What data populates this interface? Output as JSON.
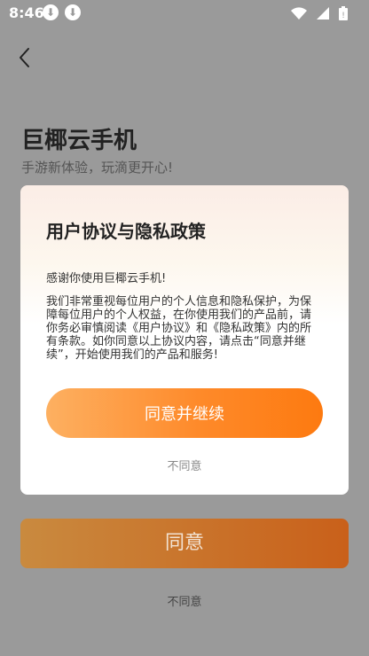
{
  "status_bar": {
    "time": "8:46",
    "icons": [
      "download-icon",
      "download-icon",
      "wifi-icon",
      "signal-icon",
      "battery-icon"
    ]
  },
  "header": {
    "app_title": "巨椰云手机",
    "subtitle": "手游新体验，玩滴更开心!"
  },
  "background_actions": {
    "agree_label": "同意",
    "disagree_label": "不同意"
  },
  "dialog": {
    "title": "用户协议与隐私政策",
    "greeting": "感谢你使用巨椰云手机!",
    "body": "我们非常重视每位用户的个人信息和隐私保护，为保障每位用户的个人权益，在你使用我们的产品前，请你务必审慎阅读《用户协议》和《隐私政策》内的所有条款。如你同意以上协议内容，请点击“同意并继续”，开始使用我们的产品和服务!",
    "agree_label": "同意并继续",
    "disagree_label": "不同意"
  },
  "colors": {
    "overlay": "#9a9a9a",
    "accent_orange": "#fd7a10",
    "dialog_bg": "#ffffff"
  }
}
